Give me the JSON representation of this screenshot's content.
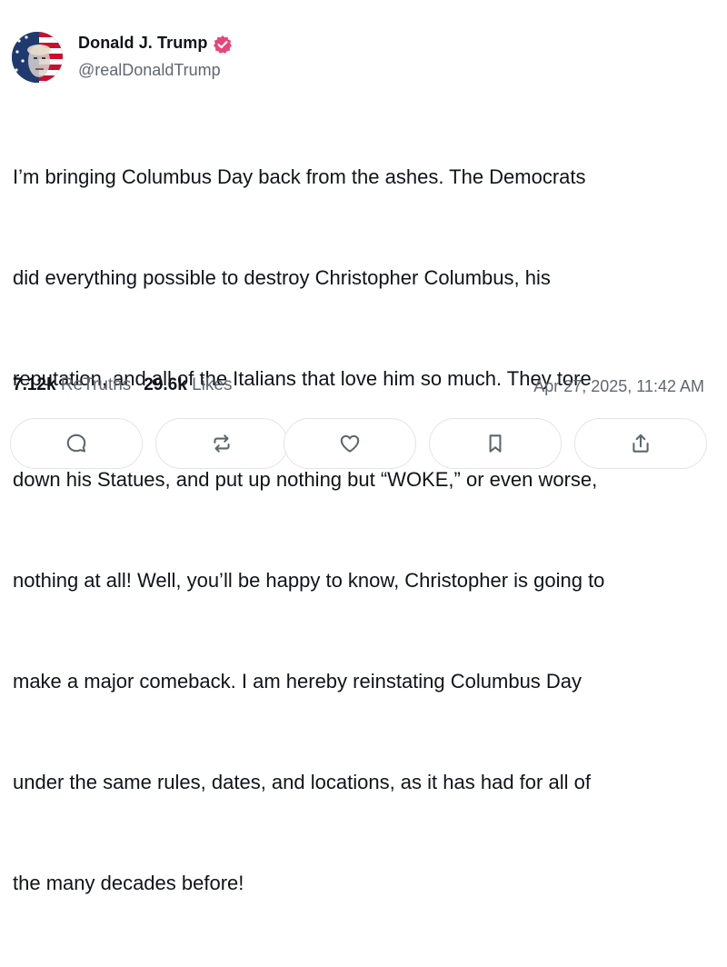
{
  "author": {
    "name": "Donald J. Trump",
    "handle": "@realDonaldTrump",
    "verified": true,
    "badge_color": "#e8447a",
    "avatar_icon": "flag-portrait-avatar"
  },
  "post": {
    "lines": [
      "I’m bringing Columbus Day back from the ashes. The Democrats",
      "did everything possible to destroy Christopher Columbus, his",
      "reputation, and all of the Italians that love him so much. They tore",
      "down his Statues, and put up nothing but “WOKE,” or even worse,",
      "nothing at all! Well, you’ll be happy to know, Christopher is going to",
      "make a major comeback. I am hereby reinstating Columbus Day",
      "under the same rules, dates, and locations, as it has had for all of",
      "the many decades before!"
    ],
    "timestamp": "Apr 27, 2025, 11:42 AM"
  },
  "stats": {
    "retruths_count": "7.12k",
    "retruths_label": "ReTruths",
    "likes_count": "29.6k",
    "likes_label": "Likes"
  },
  "actions": [
    {
      "name": "reply",
      "icon": "comment-icon"
    },
    {
      "name": "retruth",
      "icon": "repost-icon"
    },
    {
      "name": "like",
      "icon": "heart-icon"
    },
    {
      "name": "bookmark",
      "icon": "bookmark-icon"
    },
    {
      "name": "share",
      "icon": "share-icon"
    }
  ],
  "colors": {
    "text": "#0f1419",
    "secondary": "#606770",
    "border": "#e1e4e8",
    "icon": "#5b6770"
  }
}
